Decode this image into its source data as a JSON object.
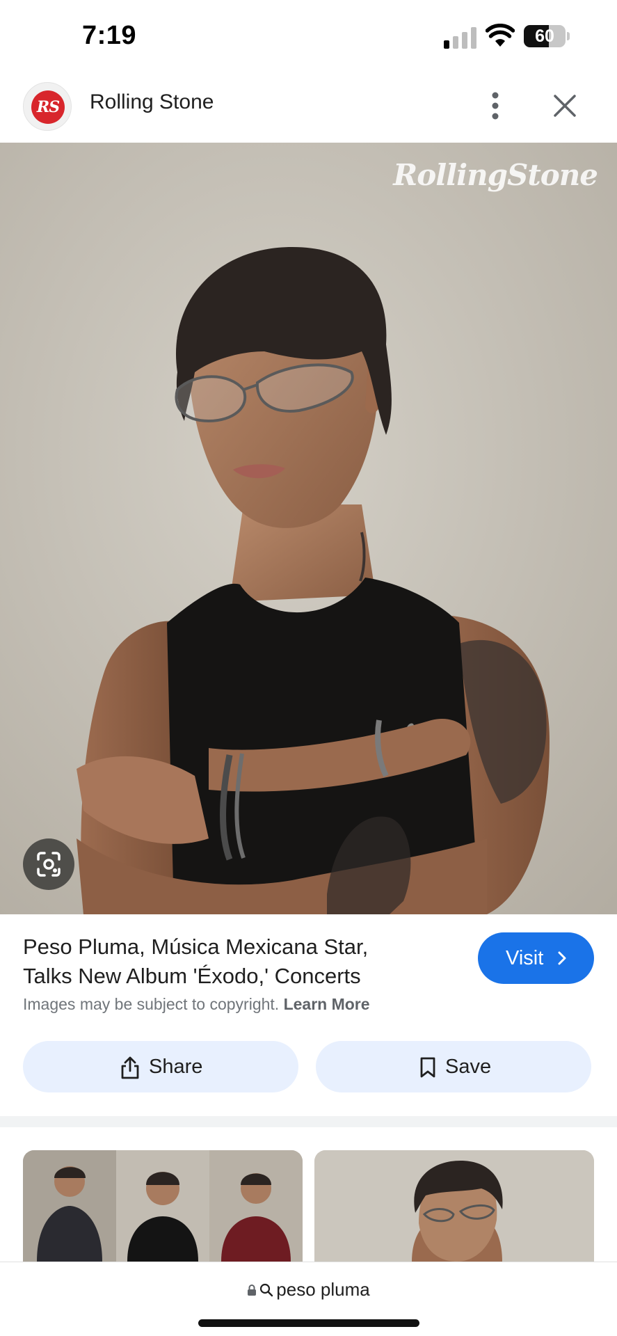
{
  "status_bar": {
    "time": "7:19",
    "battery_level": "60",
    "battery_fraction": 0.6,
    "signal_bars": 1
  },
  "header": {
    "site_logo_text": "RS",
    "site_name": "Rolling Stone"
  },
  "image": {
    "watermark": "RollingStone"
  },
  "info": {
    "title": "Peso Pluma, Música Mexicana Star, Talks New Album 'Éxodo,' Concerts",
    "copyright_text": "Images may be subject to copyright.",
    "learn_more_label": "Learn More",
    "visit_label": "Visit"
  },
  "actions": {
    "share_label": "Share",
    "save_label": "Save"
  },
  "address_bar": {
    "query": "peso pluma"
  },
  "colors": {
    "accent": "#1a73e8",
    "action_button_bg": "#e8f0fe",
    "logo_red": "#d8262c"
  },
  "icons": [
    "signal-icon",
    "wifi-icon",
    "battery-icon",
    "more-vert-icon",
    "close-icon",
    "lens-icon",
    "chevron-right-icon",
    "share-icon",
    "bookmark-icon",
    "lock-icon",
    "search-icon"
  ]
}
